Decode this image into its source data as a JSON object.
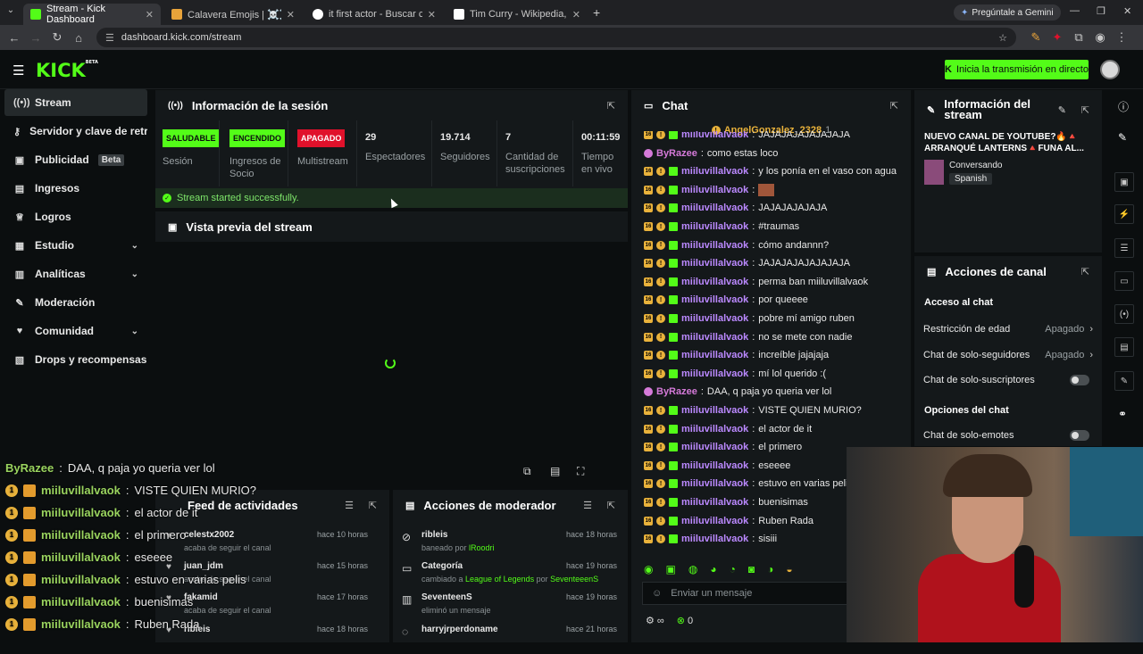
{
  "browser": {
    "tabs": [
      {
        "title": "Stream - Kick Dashboard",
        "active": true,
        "color": "#53fc18"
      },
      {
        "title": "Calavera Emojis | ☠️☠️☠️ 💀 |",
        "active": false,
        "color": "#e8a33a"
      },
      {
        "title": "it first actor - Buscar con Goog",
        "active": false,
        "color": "#4285f4"
      },
      {
        "title": "Tim Curry - Wikipedia, la encicl",
        "active": false,
        "color": "#ffffff"
      }
    ],
    "gemini_label": "Pregúntale a Gemini",
    "url": "dashboard.kick.com/stream"
  },
  "header": {
    "logo": "KICK",
    "logo_sup": "BETA",
    "go_live_label": "Inicia la transmisión en directo"
  },
  "sidebar": {
    "items": [
      {
        "label": "Stream",
        "icon": "signal-icon"
      },
      {
        "label": "Servidor y clave de retrans",
        "icon": "key-icon"
      },
      {
        "label": "Publicidad",
        "icon": "ad-icon",
        "badge": "Beta"
      },
      {
        "label": "Ingresos",
        "icon": "chart-icon"
      },
      {
        "label": "Logros",
        "icon": "trophy-icon"
      },
      {
        "label": "Estudio",
        "icon": "studio-icon"
      },
      {
        "label": "Analíticas",
        "icon": "analytics-icon"
      },
      {
        "label": "Moderación",
        "icon": "wrench-icon"
      },
      {
        "label": "Comunidad",
        "icon": "community-icon"
      },
      {
        "label": "Drops y recompensas",
        "icon": "gift-icon"
      }
    ]
  },
  "session": {
    "title": "Información de la sesión",
    "stats": [
      {
        "value": "SALUDABLE",
        "label": "Sesión",
        "badge_color": "#53fc18"
      },
      {
        "value": "ENCENDIDO",
        "label": "Ingresos de Socio",
        "badge_color": "#53fc18"
      },
      {
        "value": "APAGADO",
        "label": "Multistream",
        "badge_color": "#e0112b"
      },
      {
        "value": "29",
        "label": "Espectadores"
      },
      {
        "value": "19.714",
        "label": "Seguidores"
      },
      {
        "value": "7",
        "label": "Cantidad de suscripciones"
      },
      {
        "value": "00:11:59",
        "label": "Tiempo en vivo"
      }
    ],
    "success_msg": "Stream started successfully."
  },
  "preview": {
    "title": "Vista previa del stream"
  },
  "activity_feed": {
    "title": "Feed de actividades",
    "items": [
      {
        "name": "celestx2002",
        "desc": "acaba de seguir el canal",
        "time": "hace 10 horas"
      },
      {
        "name": "juan_jdm",
        "desc": "acaba de seguir el canal",
        "time": "hace 15 horas"
      },
      {
        "name": "fakamid",
        "desc": "acaba de seguir el canal",
        "time": "hace 17 horas"
      },
      {
        "name": "ribleis",
        "desc": "",
        "time": "hace 18 horas"
      }
    ]
  },
  "mod_actions": {
    "title": "Acciones de moderador",
    "items": [
      {
        "name": "ribleis",
        "desc_pre": "baneado por ",
        "desc_hl": "lRoodri",
        "desc_hl2": "",
        "time": "hace 18 horas",
        "icon": "ban-icon"
      },
      {
        "name": "Categoría",
        "desc_pre": "cambiado a ",
        "desc_hl": "League of Legends",
        "desc_mid": " por ",
        "desc_hl2": "SeventeeenS",
        "time": "hace 19 horas",
        "icon": "category-icon"
      },
      {
        "name": "SeventeenS",
        "desc_pre": "eliminó un mensaje",
        "desc_hl": "",
        "desc_hl2": "",
        "time": "hace 19 horas",
        "icon": "trash-icon"
      },
      {
        "name": "harryjrperdoname",
        "desc_pre": "",
        "desc_hl": "",
        "desc_hl2": "",
        "time": "hace 21 horas",
        "icon": "user-icon"
      }
    ]
  },
  "chat": {
    "title": "Chat",
    "pinned_user": "AngelGonzalez_2328",
    "pinned_count": "1",
    "messages": [
      {
        "user": "miiluvillalvaok",
        "text": "JAJAJAJAJAJAJAJA",
        "type": "sub"
      },
      {
        "user": "ByRazee",
        "text": "como estas loco",
        "type": "pink"
      },
      {
        "user": "miiluvillalvaok",
        "text": "y los ponía en el vaso con agua",
        "type": "sub"
      },
      {
        "user": "miiluvillalvaok",
        "text": "",
        "type": "sub",
        "emote": true
      },
      {
        "user": "miiluvillalvaok",
        "text": "JAJAJAJAJAJA",
        "type": "sub"
      },
      {
        "user": "miiluvillalvaok",
        "text": "#traumas",
        "type": "sub"
      },
      {
        "user": "miiluvillalvaok",
        "text": "cómo andannn?",
        "type": "sub"
      },
      {
        "user": "miiluvillalvaok",
        "text": "JAJAJAJAJAJAJAJA",
        "type": "sub"
      },
      {
        "user": "miiluvillalvaok",
        "text": "perma ban miiluvillalvaok",
        "type": "sub"
      },
      {
        "user": "miiluvillalvaok",
        "text": "por queeee",
        "type": "sub"
      },
      {
        "user": "miiluvillalvaok",
        "text": "pobre mí amigo ruben",
        "type": "sub"
      },
      {
        "user": "miiluvillalvaok",
        "text": "no se mete con nadie",
        "type": "sub"
      },
      {
        "user": "miiluvillalvaok",
        "text": "increíble jajajaja",
        "type": "sub"
      },
      {
        "user": "miiluvillalvaok",
        "text": "mí lol querido :(",
        "type": "sub"
      },
      {
        "user": "ByRazee",
        "text": "DAA, q paja yo queria ver lol",
        "type": "pink"
      },
      {
        "user": "miiluvillalvaok",
        "text": "VISTE QUIEN MURIO?",
        "type": "sub"
      },
      {
        "user": "miiluvillalvaok",
        "text": "el actor de it",
        "type": "sub"
      },
      {
        "user": "miiluvillalvaok",
        "text": "el primero",
        "type": "sub"
      },
      {
        "user": "miiluvillalvaok",
        "text": "eseeee",
        "type": "sub"
      },
      {
        "user": "miiluvillalvaok",
        "text": "estuvo en varias pelis",
        "type": "sub"
      },
      {
        "user": "miiluvillalvaok",
        "text": "buenisimas",
        "type": "sub"
      },
      {
        "user": "miiluvillalvaok",
        "text": "Ruben Rada",
        "type": "sub"
      },
      {
        "user": "miiluvillalvaok",
        "text": "sisiii",
        "type": "sub"
      }
    ],
    "input_placeholder": "Enviar un mensaje",
    "points": "0"
  },
  "stream_info": {
    "title": "Información del stream",
    "stream_title": "NUEVO CANAL DE YOUTUBE?🔥🔺 ARRANQUÉ LANTERNS🔺FUNA AL...",
    "category": "Conversando",
    "language": "Spanish"
  },
  "channel_actions": {
    "title": "Acciones de canal",
    "section1": "Acceso al chat",
    "rows": [
      {
        "label": "Restricción de edad",
        "value": "Apagado"
      },
      {
        "label": "Chat de solo-seguidores",
        "value": "Apagado"
      }
    ],
    "sub_only": "Chat de solo-suscriptores",
    "section2": "Opciones del chat",
    "emote_only": "Chat de solo-emotes"
  },
  "overlay_chat": [
    {
      "user": "ByRazee",
      "text": "DAA, q paja yo queria ver lol",
      "pink": true
    },
    {
      "user": "miiluvillalvaok",
      "text": "VISTE QUIEN MURIO?"
    },
    {
      "user": "miiluvillalvaok",
      "text": "el actor de it"
    },
    {
      "user": "miiluvillalvaok",
      "text": "el primero"
    },
    {
      "user": "miiluvillalvaok",
      "text": "eseeee"
    },
    {
      "user": "miiluvillalvaok",
      "text": "estuvo en varias pelis"
    },
    {
      "user": "miiluvillalvaok",
      "text": "buenisimas"
    },
    {
      "user": "miiluvillalvaok",
      "text": "Ruben Rada"
    }
  ]
}
